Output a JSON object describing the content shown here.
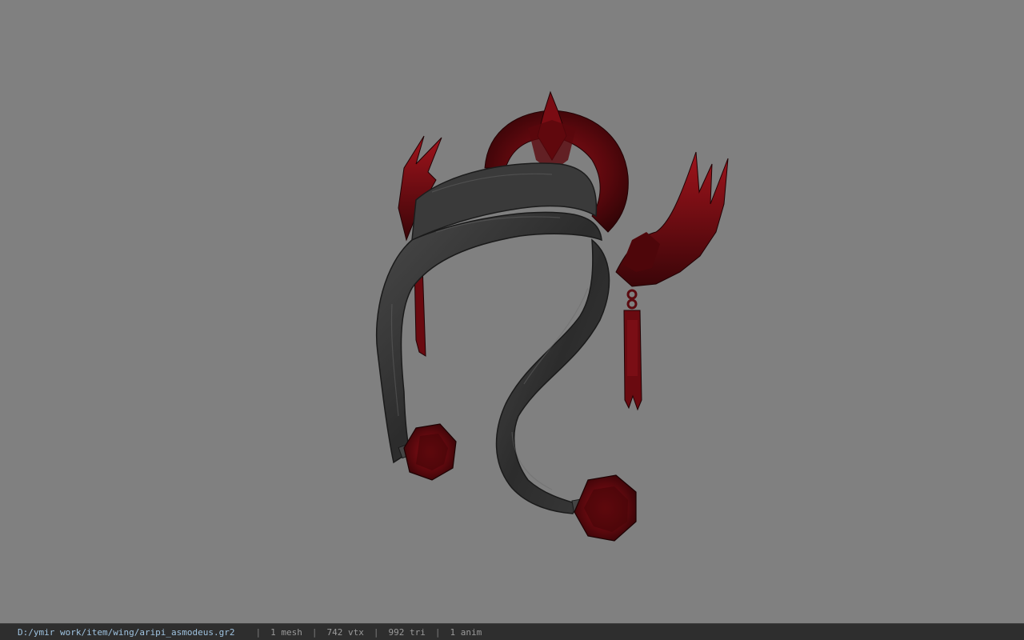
{
  "viewport": {
    "background": "#808080",
    "model_description_icon": "headband-model-icon"
  },
  "statusbar": {
    "file_path": "D:/ymir work/item/wing/aripi_asmodeus.gr2",
    "separator": "|",
    "mesh_count": "1 mesh",
    "vertex_count": "742 vtx",
    "triangle_count": "992 tri",
    "anim_count": "1 anim"
  },
  "colors": {
    "band_dark": "#2a2a2a",
    "band_mid": "#3e3e3e",
    "band_light": "#555555",
    "ornament_red": "#6e0a10",
    "ornament_red_dark": "#3a0508",
    "ornament_red_bright": "#a01820",
    "statusbar_bg": "#2e2e2e",
    "path_text": "#9fc3e0"
  }
}
